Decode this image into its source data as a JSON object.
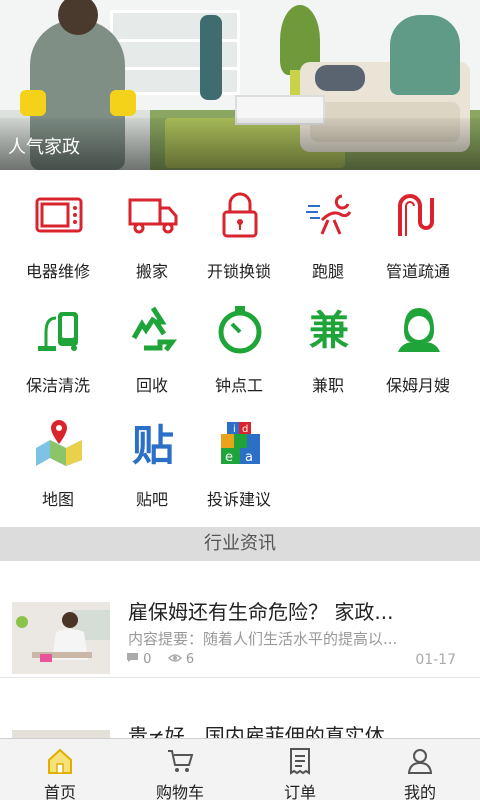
{
  "banner": {
    "title": "人气家政"
  },
  "services": [
    {
      "label": "电器维修",
      "icon": "microwave-icon",
      "color": "#d9242e"
    },
    {
      "label": "搬家",
      "icon": "truck-icon",
      "color": "#d9242e"
    },
    {
      "label": "开锁换锁",
      "icon": "padlock-icon",
      "color": "#d9242e"
    },
    {
      "label": "跑腿",
      "icon": "running-errand-icon",
      "color": "#d9242e"
    },
    {
      "label": "管道疏通",
      "icon": "pipe-icon",
      "color": "#d9242e"
    },
    {
      "label": "保洁清洗",
      "icon": "vacuum-cleaner-icon",
      "color": "#1fa43a"
    },
    {
      "label": "回收",
      "icon": "recycle-icon",
      "color": "#1fa43a"
    },
    {
      "label": "钟点工",
      "icon": "stopwatch-icon",
      "color": "#1fa43a"
    },
    {
      "label": "兼职",
      "icon": "part-time-jian-icon",
      "color": "#1fa43a"
    },
    {
      "label": "保姆月嫂",
      "icon": "nanny-icon",
      "color": "#1fa43a"
    },
    {
      "label": "地图",
      "icon": "map-pin-icon",
      "color": "#2b6fc7"
    },
    {
      "label": "贴吧",
      "icon": "tieba-icon",
      "color": "#2b6fc7"
    },
    {
      "label": "投诉建议",
      "icon": "idea-blocks-icon",
      "color": "#2b6fc7"
    }
  ],
  "section": {
    "title": "行业资讯"
  },
  "news": [
    {
      "title": "雇保姆还有生命危险？ 家政...",
      "summary": "内容提要：随着人们生活水平的提高以...",
      "comments": "0",
      "views": "6",
      "date": "01-17"
    },
    {
      "title": "贵≠好，国内雇菲佣的真实体...",
      "summary": "",
      "comments": "",
      "views": "",
      "date": ""
    }
  ],
  "tabs": [
    {
      "label": "首页",
      "icon": "home-icon",
      "active": true
    },
    {
      "label": "购物车",
      "icon": "cart-icon",
      "active": false
    },
    {
      "label": "订单",
      "icon": "receipt-icon",
      "active": false
    },
    {
      "label": "我的",
      "icon": "user-icon",
      "active": false
    }
  ],
  "colors": {
    "red": "#d9242e",
    "green": "#1fa43a",
    "blue": "#2b6fc7",
    "tabActive": "#f2c400"
  }
}
